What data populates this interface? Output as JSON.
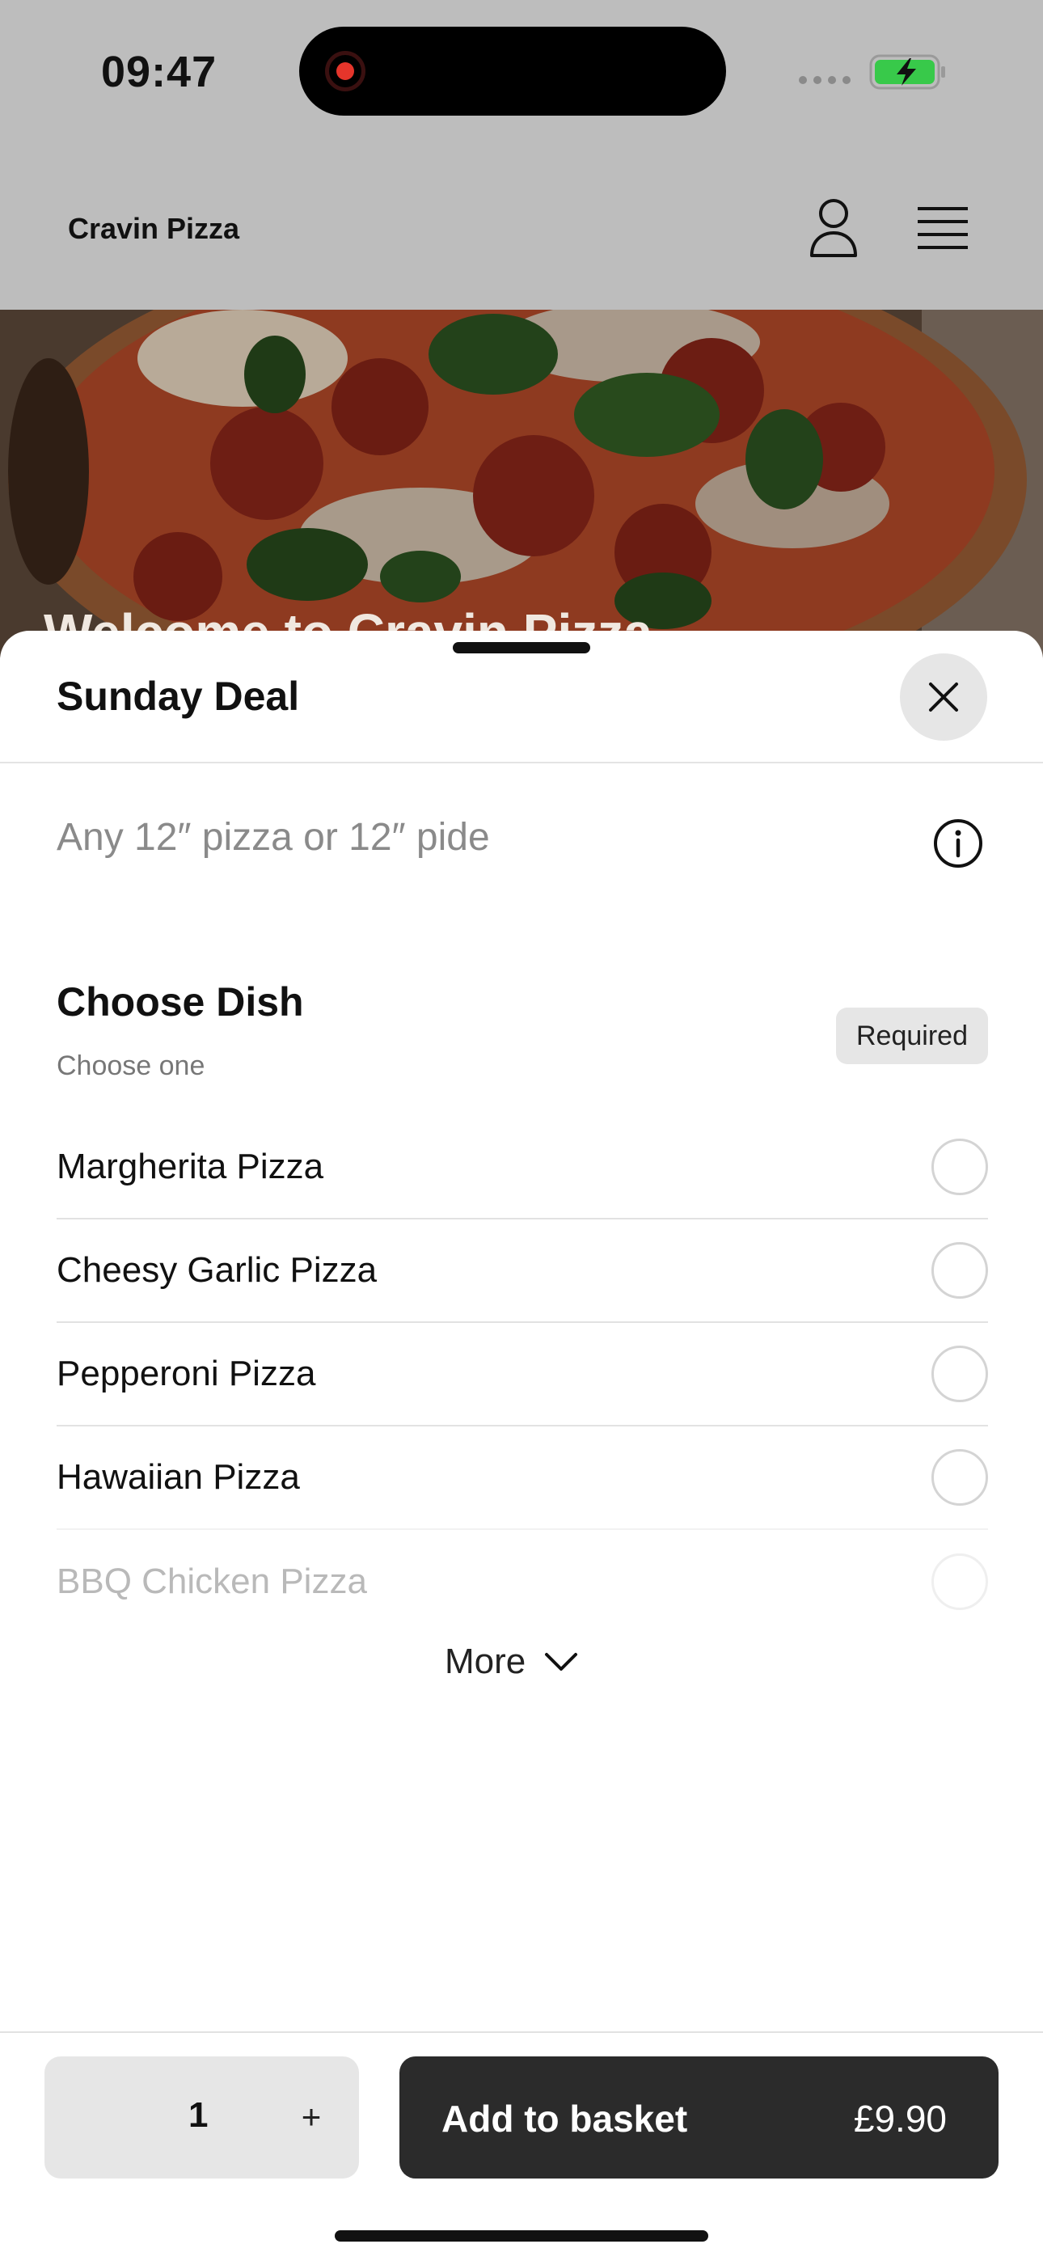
{
  "status_bar": {
    "time": "09:47"
  },
  "header": {
    "brand": "Cravin Pizza"
  },
  "hero": {
    "text": "Welcome to Cravin Pizza"
  },
  "sheet": {
    "title": "Sunday Deal",
    "description": "Any 12″ pizza or 12″ pide",
    "section": {
      "title": "Choose Dish",
      "subtitle": "Choose one",
      "badge": "Required",
      "options": [
        {
          "label": "Margherita Pizza"
        },
        {
          "label": "Cheesy Garlic Pizza"
        },
        {
          "label": "Pepperoni Pizza"
        },
        {
          "label": "Hawaiian Pizza"
        },
        {
          "label": "BBQ Chicken Pizza"
        }
      ]
    },
    "more_label": "More"
  },
  "footer": {
    "quantity": "1",
    "plus": "+",
    "add_label": "Add to basket",
    "price": "£9.90"
  },
  "colors": {
    "overlay": "#bdbdbd",
    "accent_dark": "#2b2b2b",
    "battery_green": "#38c94a",
    "recording_red": "#e5352b"
  }
}
